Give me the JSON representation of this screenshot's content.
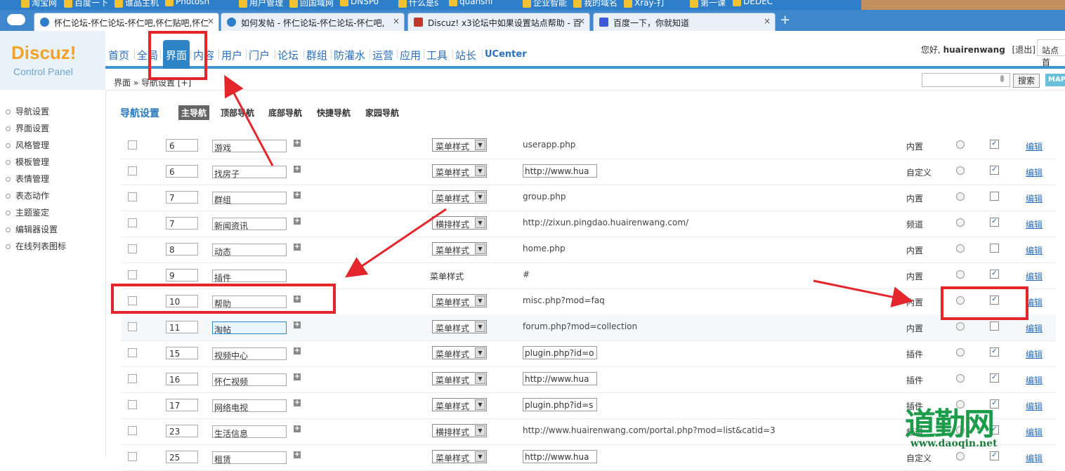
{
  "bookmarks": [
    "淘宝网",
    "百度一下",
    "谁品主机",
    "Photosh",
    "用户管理",
    "回国域网",
    "DNSPo",
    "什么是s",
    "quanshi",
    "企业智能",
    "我的域名",
    "Xray-打",
    "第一课",
    "DEDEC"
  ],
  "browser": {
    "tabs": [
      {
        "label": "怀仁论坛-怀仁论坛-怀仁吧,怀仁贴吧,怀仁",
        "close": "×"
      },
      {
        "label": "如何发帖 - 怀仁论坛-怀仁论坛-怀仁吧,",
        "close": "×"
      },
      {
        "label": "Discuz! x3论坛中如果设置站点帮助 - 百",
        "close": "×"
      },
      {
        "label": "百度一下，你就知道",
        "close": "×"
      }
    ],
    "new_tab": "+"
  },
  "logo": {
    "brand": "Discuz!",
    "sub": "Control Panel"
  },
  "nav": {
    "items": [
      "首页",
      "全局",
      "界面",
      "内容",
      "用户",
      "门户",
      "论坛",
      "群组",
      "防灌水",
      "运营",
      "应用",
      "工具",
      "站长",
      "UCenter"
    ],
    "active": "界面"
  },
  "user": {
    "greeting": "您好,",
    "name": "huairenwang",
    "logout": "[退出]",
    "site": "站点首"
  },
  "breadcrumb": "界面 » 导航设置 [+]",
  "search": {
    "button": "搜索",
    "map": "MAP"
  },
  "sidebar": [
    "导航设置",
    "界面设置",
    "风格管理",
    "模板管理",
    "表情管理",
    "表态动作",
    "主题鉴定",
    "编辑器设置",
    "在线列表图标"
  ],
  "page": {
    "title": "导航设置",
    "subtabs": [
      "主导航",
      "顶部导航",
      "底部导航",
      "快捷导航",
      "家园导航"
    ],
    "active_subtab": "主导航"
  },
  "rows": [
    {
      "order": "6",
      "name": "游戏",
      "style": "菜单样式",
      "url": "userapp.php",
      "type": "内置",
      "show": true,
      "edit": "编辑",
      "plus": true,
      "urlbox": false
    },
    {
      "order": "6",
      "name": "找房子",
      "style": "菜单样式",
      "url": "http://www.hua",
      "type": "自定义",
      "show": true,
      "edit": "编辑",
      "plus": true,
      "urlbox": true
    },
    {
      "order": "7",
      "name": "群组",
      "style": "菜单样式",
      "url": "group.php",
      "type": "内置",
      "show": false,
      "edit": "编辑",
      "plus": true,
      "urlbox": false
    },
    {
      "order": "7",
      "name": "新闻资讯",
      "style": "横排样式",
      "url": "http://zixun.pingdao.huairenwang.com/",
      "type": "频道",
      "show": true,
      "edit": "编辑",
      "plus": true,
      "urlbox": false
    },
    {
      "order": "8",
      "name": "动态",
      "style": "菜单样式",
      "url": "home.php",
      "type": "内置",
      "show": false,
      "edit": "编辑",
      "plus": true,
      "urlbox": false
    },
    {
      "order": "9",
      "name": "插件",
      "style": "菜单样式",
      "url": "#",
      "type": "内置",
      "show": true,
      "edit": "编辑",
      "plus": false,
      "urlbox": false,
      "plain_style": true
    },
    {
      "order": "10",
      "name": "帮助",
      "style": "菜单样式",
      "url": "misc.php?mod=faq",
      "type": "内置",
      "show": true,
      "edit": "编辑",
      "plus": true,
      "urlbox": false
    },
    {
      "order": "11",
      "name": "淘帖",
      "style": "菜单样式",
      "url": "forum.php?mod=collection",
      "type": "内置",
      "show": false,
      "edit": "编辑",
      "plus": true,
      "urlbox": false,
      "focus": true
    },
    {
      "order": "15",
      "name": "视频中心",
      "style": "菜单样式",
      "url": "plugin.php?id=o",
      "type": "插件",
      "show": true,
      "edit": "编辑",
      "plus": true,
      "urlbox": true
    },
    {
      "order": "16",
      "name": "怀仁视频",
      "style": "菜单样式",
      "url": "http://www.hua",
      "type": "插件",
      "show": true,
      "edit": "编辑",
      "plus": true,
      "urlbox": true
    },
    {
      "order": "17",
      "name": "网络电视",
      "style": "菜单样式",
      "url": "plugin.php?id=s",
      "type": "插件",
      "show": true,
      "edit": "编辑",
      "plus": true,
      "urlbox": true
    },
    {
      "order": "23",
      "name": "生活信息",
      "style": "横排样式",
      "url": "http://www.huairenwang.com/portal.php?mod=list&catid=3",
      "type": "频道",
      "show": true,
      "edit": "编辑",
      "plus": true,
      "urlbox": false
    },
    {
      "order": "25",
      "name": "租赁",
      "style": "菜单样式",
      "url": "http://www.hua",
      "type": "自定义",
      "show": true,
      "edit": "编辑",
      "plus": true,
      "urlbox": true
    }
  ],
  "watermark": {
    "cn": "道勤网",
    "url": "www.daoqin.net"
  },
  "colors": {
    "annotation": "#e3262c",
    "accent": "#2a78bd",
    "nav_active": "#2d85c8"
  }
}
